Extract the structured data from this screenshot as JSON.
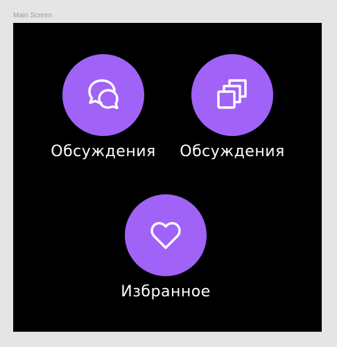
{
  "frame": {
    "label": "Main Screen"
  },
  "colors": {
    "accent": "#a162f7",
    "background": "#000000",
    "text": "#ffffff"
  },
  "tiles": [
    {
      "label": "Обсуждения",
      "icon": "chat-bubbles-icon"
    },
    {
      "label": "Обсуждения",
      "icon": "stacked-squares-icon"
    },
    {
      "label": "Избранное",
      "icon": "heart-icon"
    }
  ]
}
